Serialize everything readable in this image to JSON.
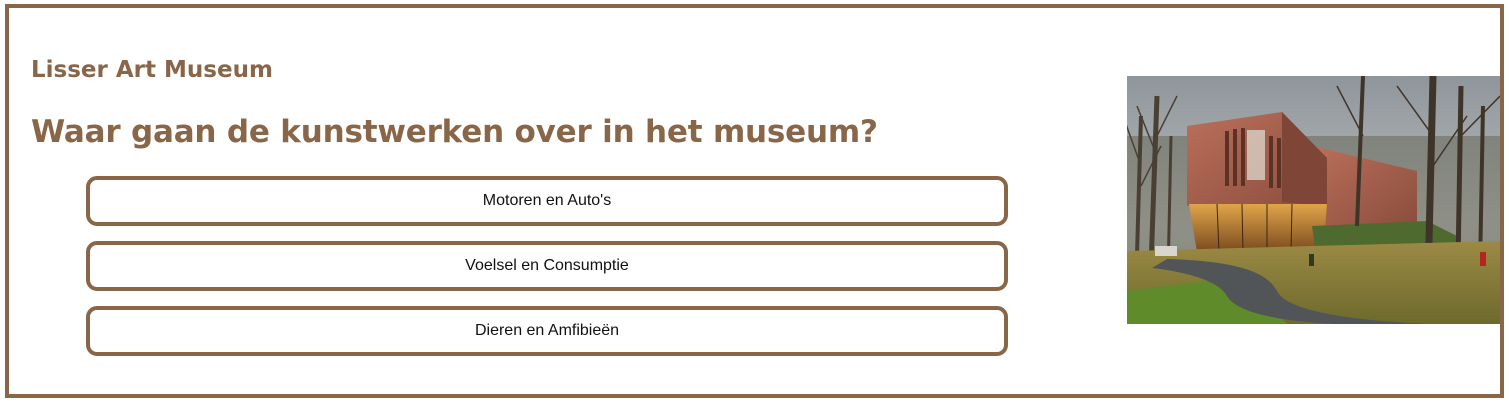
{
  "app": {
    "brand": "Lisser Art Museum"
  },
  "quiz": {
    "question": "Waar gaan de kunstwerken over in het museum?",
    "answers": [
      {
        "label": "Motoren en Auto's"
      },
      {
        "label": "Voelsel en Consumptie"
      },
      {
        "label": "Dieren en Amfibieën"
      }
    ]
  },
  "colors": {
    "accent": "#8a6648",
    "text": "#111111",
    "background": "#ffffff"
  },
  "image": {
    "subject": "museum-building-photo"
  }
}
